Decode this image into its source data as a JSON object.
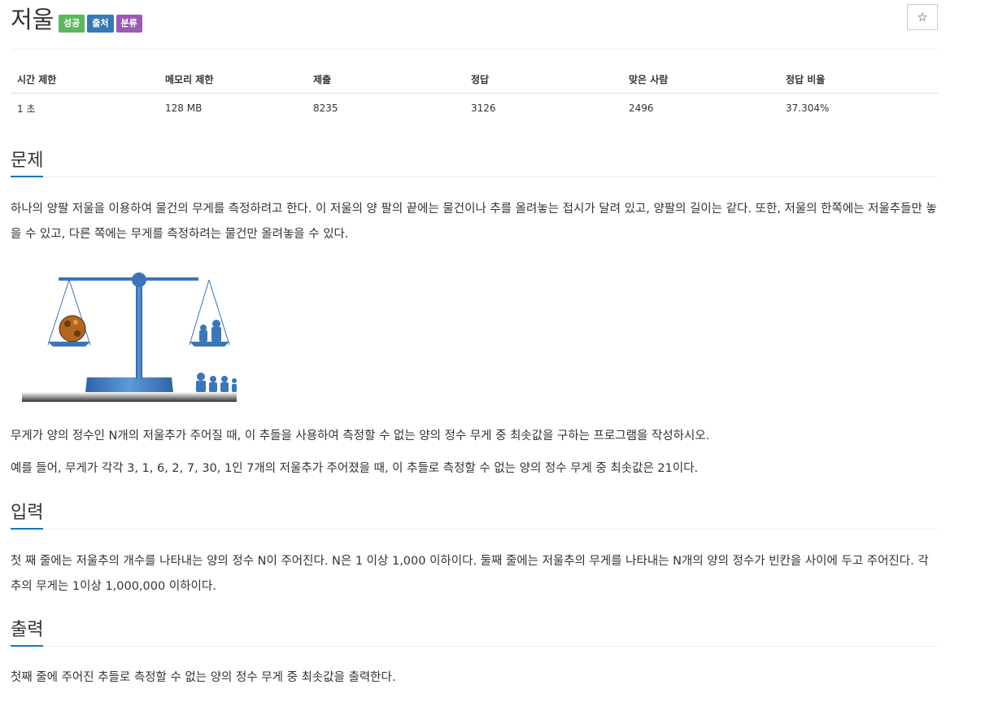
{
  "problem": {
    "title": "저울",
    "labels": [
      {
        "text": "성공",
        "color": "#5cb85c"
      },
      {
        "text": "출처",
        "color": "#337ab7"
      },
      {
        "text": "분류",
        "color": "#9b59b6"
      }
    ],
    "star_icon": "☆"
  },
  "stats": {
    "headers": [
      "시간 제한",
      "메모리 제한",
      "제출",
      "정답",
      "맞은 사람",
      "정답 비율"
    ],
    "values": [
      "1 초",
      "128 MB",
      "8235",
      "3126",
      "2496",
      "37.304%"
    ]
  },
  "sections": {
    "description": {
      "heading": "문제",
      "para1": "하나의 양팔 저울을 이용하여 물건의 무게를 측정하려고 한다. 이 저울의 양 팔의 끝에는 물건이나 추를 올려놓는 접시가 달려 있고, 양팔의 길이는 같다. 또한, 저울의 한쪽에는 저울추들만 놓을 수 있고, 다른 쪽에는 무게를 측정하려는 물건만 올려놓을 수 있다.",
      "para2": "무게가 양의 정수인 N개의 저울추가 주어질 때, 이 추들을 사용하여 측정할 수 없는 양의 정수 무게 중 최솟값을 구하는 프로그램을 작성하시오.",
      "para3": "예를 들어, 무게가 각각 3, 1, 6, 2, 7, 30, 1인 7개의 저울추가 주어졌을 때, 이 추들로 측정할 수 없는 양의 정수 무게 중 최솟값은 21이다."
    },
    "input": {
      "heading": "입력",
      "para": "첫 째 줄에는 저울추의 개수를 나타내는 양의 정수 N이 주어진다. N은 1 이상 1,000 이하이다. 둘째 줄에는 저울추의 무게를 나타내는 N개의 양의 정수가 빈칸을 사이에 두고 주어진다. 각 추의 무게는 1이상 1,000,000 이하이다."
    },
    "output": {
      "heading": "출력",
      "para": "첫째 줄에 주어진 추들로 측정할 수 없는 양의 정수 무게 중 최솟값을 출력한다."
    }
  },
  "colors": {
    "accent": "#0d7ab7",
    "scale_blue": "#3a76b8"
  }
}
